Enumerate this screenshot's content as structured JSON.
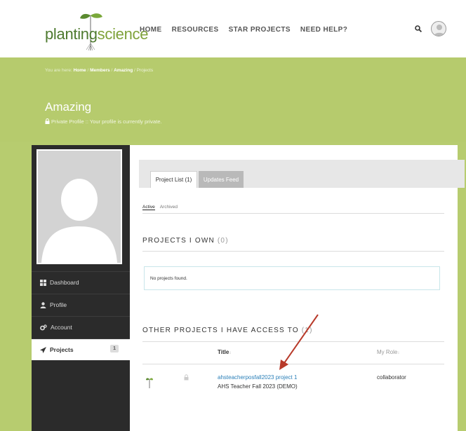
{
  "brand": {
    "part1": "planting",
    "part2": "science"
  },
  "nav": [
    "HOME",
    "RESOURCES",
    "STAR PROJECTS",
    "NEED HELP?"
  ],
  "breadcrumb": {
    "prefix": "You are here:",
    "items": [
      "Home",
      "Members",
      "Amazing"
    ],
    "current": "Projects",
    "sep": "/"
  },
  "profile": {
    "name": "Amazing",
    "privacy": "Private Profile :: Your profile is currently private."
  },
  "sidebar": {
    "items": [
      {
        "label": "Dashboard",
        "icon": "grid-icon"
      },
      {
        "label": "Profile",
        "icon": "user-icon"
      },
      {
        "label": "Account",
        "icon": "gear-icon"
      },
      {
        "label": "Projects",
        "icon": "send-icon",
        "count": "1"
      }
    ]
  },
  "tabs": [
    "Project List (1)",
    "Updates Feed"
  ],
  "subtabs": [
    "Active",
    "Archived"
  ],
  "own": {
    "heading": "PROJECTS I OWN",
    "count": "(0)",
    "empty": "No projects found."
  },
  "other": {
    "heading": "OTHER PROJECTS I HAVE ACCESS TO",
    "count": "(1)",
    "col_title": "Title",
    "col_role": "My Role",
    "sort_glyph": "↕",
    "rows": [
      {
        "title": "ahsteacherposfall2023 project 1",
        "subtitle": "AHS Teacher Fall 2023 (DEMO)",
        "role": "collaborator"
      }
    ]
  },
  "colors": {
    "green": "#b6cb6d",
    "link": "#2a7fb8",
    "sidebar": "#2b2b2b",
    "annotation_arrow": "#b83a2a"
  }
}
